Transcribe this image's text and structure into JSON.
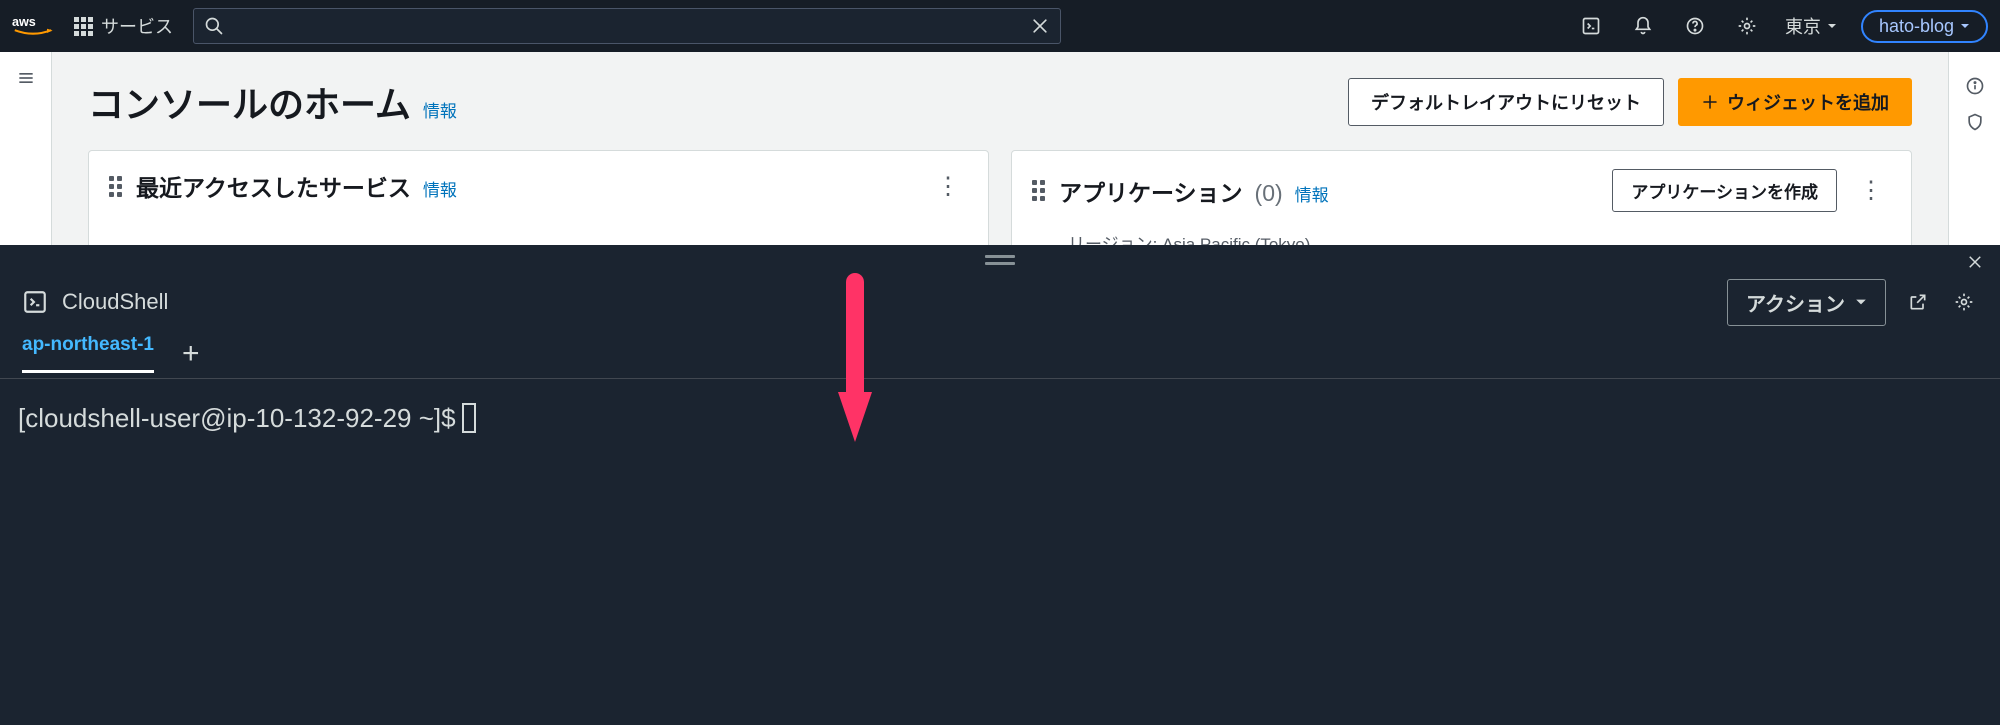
{
  "topnav": {
    "services_label": "サービス",
    "search_placeholder": "",
    "region_label": "東京",
    "user_label": "hato-blog"
  },
  "page": {
    "title": "コンソールのホーム",
    "info_link": "情報",
    "reset_layout_btn": "デフォルトレイアウトにリセット",
    "add_widget_btn": "ウィジェットを追加"
  },
  "widgets": {
    "recent": {
      "title": "最近アクセスしたサービス",
      "info_link": "情報"
    },
    "apps": {
      "title": "アプリケーション",
      "count": "(0)",
      "info_link": "情報",
      "create_btn": "アプリケーションを作成",
      "region_label": "リージョン: Asia Pacific (Tokyo)"
    }
  },
  "cloudshell": {
    "title": "CloudShell",
    "actions_btn": "アクション",
    "tab_label": "ap-northeast-1",
    "prompt": "[cloudshell-user@ip-10-132-92-29 ~]$"
  }
}
